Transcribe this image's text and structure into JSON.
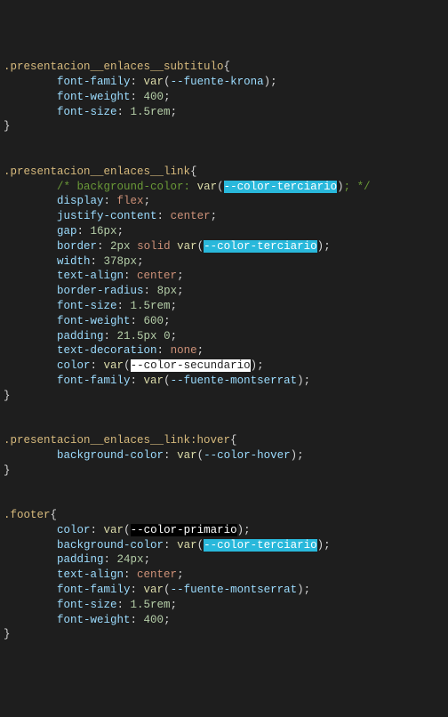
{
  "rules": [
    {
      "selector": ".presentacion__enlaces__subtitulo",
      "decls": [
        {
          "prop": "font-family",
          "items": [
            {
              "t": "func",
              "fn": "var",
              "arg": "--fuente-krona",
              "hl": null
            }
          ]
        },
        {
          "prop": "font-weight",
          "items": [
            {
              "t": "num",
              "v": "400"
            }
          ]
        },
        {
          "prop": "font-size",
          "items": [
            {
              "t": "num",
              "v": "1.5rem"
            }
          ]
        }
      ]
    },
    {
      "selector": ".presentacion__enlaces__link",
      "decls": [
        {
          "comment": true,
          "prop": "background-color",
          "items": [
            {
              "t": "func",
              "fn": "var",
              "arg": "--color-terciario",
              "hl": "cyan"
            }
          ]
        },
        {
          "prop": "display",
          "items": [
            {
              "t": "kw",
              "v": "flex"
            }
          ]
        },
        {
          "prop": "justify-content",
          "items": [
            {
              "t": "kw",
              "v": "center"
            }
          ]
        },
        {
          "prop": "gap",
          "items": [
            {
              "t": "num",
              "v": "16px"
            }
          ]
        },
        {
          "prop": "border",
          "items": [
            {
              "t": "num",
              "v": "2px"
            },
            {
              "t": "kw",
              "v": "solid"
            },
            {
              "t": "func",
              "fn": "var",
              "arg": "--color-terciario",
              "hl": "cyan"
            }
          ]
        },
        {
          "prop": "width",
          "items": [
            {
              "t": "num",
              "v": "378px"
            }
          ]
        },
        {
          "prop": "text-align",
          "items": [
            {
              "t": "kw",
              "v": "center"
            }
          ]
        },
        {
          "prop": "border-radius",
          "items": [
            {
              "t": "num",
              "v": "8px"
            }
          ]
        },
        {
          "prop": "font-size",
          "items": [
            {
              "t": "num",
              "v": "1.5rem"
            }
          ]
        },
        {
          "prop": "font-weight",
          "items": [
            {
              "t": "num",
              "v": "600"
            }
          ]
        },
        {
          "prop": "padding",
          "items": [
            {
              "t": "num",
              "v": "21.5px"
            },
            {
              "t": "num",
              "v": "0"
            }
          ]
        },
        {
          "prop": "text-decoration",
          "items": [
            {
              "t": "kw",
              "v": "none"
            }
          ]
        },
        {
          "prop": "color",
          "items": [
            {
              "t": "func",
              "fn": "var",
              "arg": "--color-secundario",
              "hl": "white"
            }
          ]
        },
        {
          "prop": "font-family",
          "items": [
            {
              "t": "func",
              "fn": "var",
              "arg": "--fuente-montserrat",
              "hl": null
            }
          ]
        }
      ]
    },
    {
      "selector": ".presentacion__enlaces__link:hover",
      "decls": [
        {
          "prop": "background-color",
          "items": [
            {
              "t": "func",
              "fn": "var",
              "arg": "--color-hover",
              "hl": null
            }
          ]
        }
      ]
    },
    {
      "selector": ".footer",
      "decls": [
        {
          "prop": "color",
          "items": [
            {
              "t": "func",
              "fn": "var",
              "arg": "--color-primario",
              "hl": "black"
            }
          ]
        },
        {
          "prop": "background-color",
          "items": [
            {
              "t": "func",
              "fn": "var",
              "arg": "--color-terciario",
              "hl": "cyan"
            }
          ]
        },
        {
          "prop": "padding",
          "items": [
            {
              "t": "num",
              "v": "24px"
            }
          ]
        },
        {
          "prop": "text-align",
          "items": [
            {
              "t": "kw",
              "v": "center"
            }
          ]
        },
        {
          "prop": "font-family",
          "items": [
            {
              "t": "func",
              "fn": "var",
              "arg": "--fuente-montserrat",
              "hl": null
            }
          ]
        },
        {
          "prop": "font-size",
          "items": [
            {
              "t": "num",
              "v": "1.5rem"
            }
          ]
        },
        {
          "prop": "font-weight",
          "items": [
            {
              "t": "num",
              "v": "400"
            }
          ]
        }
      ]
    }
  ],
  "indent": "    "
}
